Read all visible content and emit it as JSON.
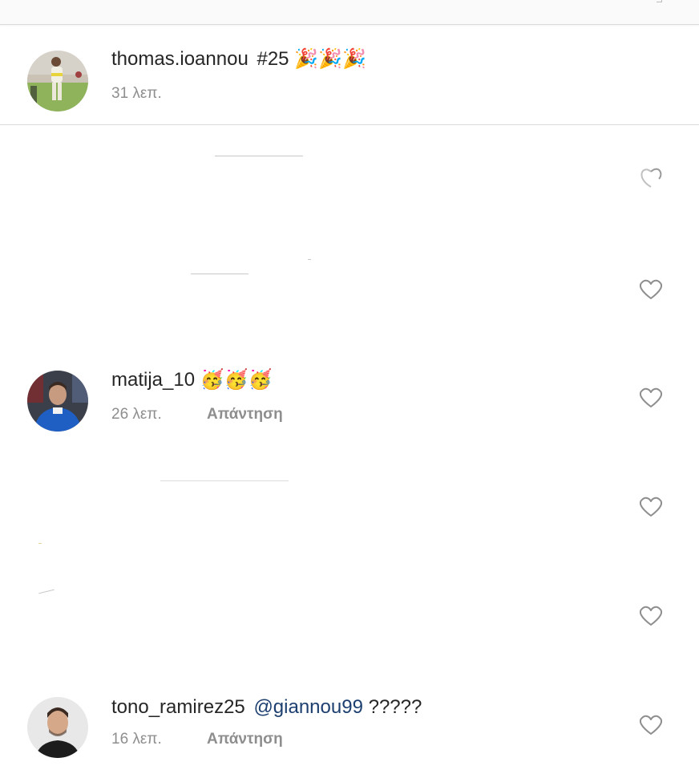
{
  "caption": {
    "username": "thomas.ioannou",
    "text": "#25",
    "emojis": "🎉🎉🎉",
    "time": "31 λεπ."
  },
  "comments": [
    {
      "username": "matija_10",
      "text": "",
      "emojis": "🥳🥳🥳",
      "time": "26 λεπ.",
      "reply": "Απάντηση"
    },
    {
      "username": "tono_ramirez25",
      "mention": "@giannou99",
      "text": "?????",
      "time": "16 λεπ.",
      "reply": "Απάντηση"
    }
  ],
  "colors": {
    "text": "#262626",
    "secondary": "#8e8e8e",
    "mention": "#1c3f70",
    "divider": "#dbdbdb"
  },
  "icons": {
    "like": "heart-outline-icon"
  }
}
